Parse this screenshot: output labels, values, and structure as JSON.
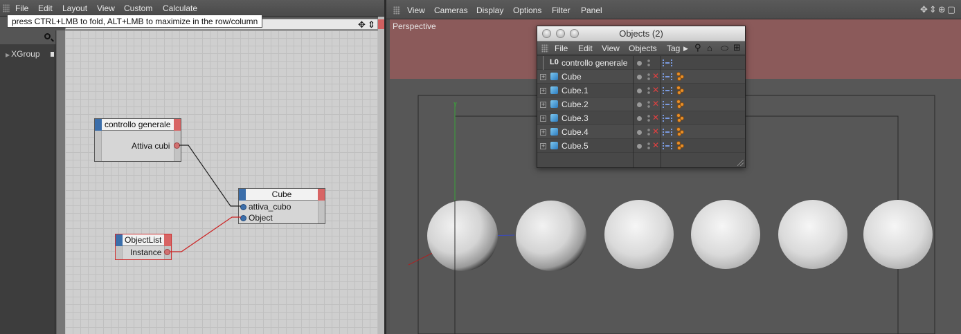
{
  "left_panel": {
    "menu": [
      "File",
      "Edit",
      "Layout",
      "View",
      "Custom",
      "Calculate"
    ],
    "tooltip": "press CTRL+LMB to fold, ALT+LMB to maximize in the row/column",
    "tree_item": "XGroup"
  },
  "nodes": {
    "controllo": {
      "title": "controllo generale",
      "port": "Attiva cubi"
    },
    "cube": {
      "title": "Cube",
      "ports": [
        "attiva_cubo",
        "Object"
      ]
    },
    "objectlist": {
      "title": "ObjectList",
      "port": "Instance"
    }
  },
  "viewport": {
    "menu": [
      "View",
      "Cameras",
      "Display",
      "Options",
      "Filter",
      "Panel"
    ],
    "camera_label": "Perspective",
    "nav_icons": "✥⇕⊕▢"
  },
  "objects_window": {
    "title": "Objects (2)",
    "menu": [
      "File",
      "Edit",
      "View",
      "Objects",
      "Tag"
    ],
    "rows": [
      {
        "name": "controllo generale",
        "type": "null",
        "expandable": false
      },
      {
        "name": "Cube",
        "type": "cube",
        "expandable": true
      },
      {
        "name": "Cube.1",
        "type": "cube",
        "expandable": true
      },
      {
        "name": "Cube.2",
        "type": "cube",
        "expandable": true
      },
      {
        "name": "Cube.3",
        "type": "cube",
        "expandable": true
      },
      {
        "name": "Cube.4",
        "type": "cube",
        "expandable": true
      },
      {
        "name": "Cube.5",
        "type": "cube",
        "expandable": true
      }
    ]
  },
  "colors": {
    "input_port": "#3b6eaa",
    "output_port": "#d86464",
    "wire_selected": "#cc2222",
    "viewport_bg": "#575757",
    "viewport_top": "#8b5a5a"
  }
}
